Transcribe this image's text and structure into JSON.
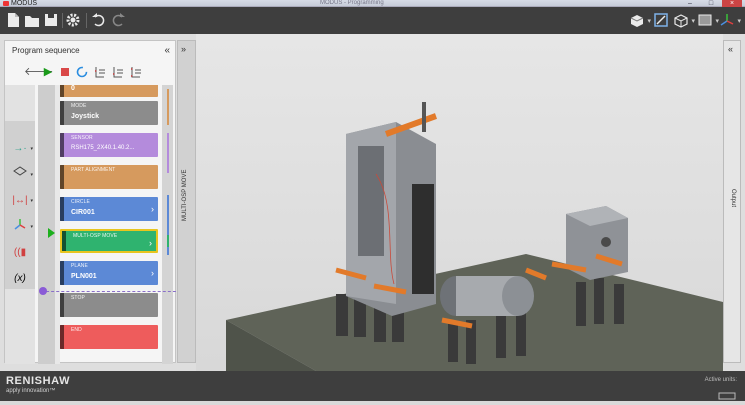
{
  "window": {
    "title": "MODUS",
    "center_text": "MODUS - Programming"
  },
  "toolbar": {
    "icons": [
      "new-file-icon",
      "open-folder-icon",
      "save-icon",
      "settings-icon",
      "undo-icon",
      "redo-icon"
    ],
    "right_icons": [
      "cube-icon",
      "zoom-fit-icon",
      "view-cube-icon",
      "display-mode-icon",
      "axes-icon"
    ]
  },
  "sequence": {
    "title": "Program sequence",
    "collapse": "«",
    "tools": [
      "back-icon",
      "play-icon",
      "stop-icon",
      "refresh-icon",
      "step-icon",
      "step-back-icon",
      "step-all-icon"
    ],
    "cards": [
      {
        "label": "",
        "value": "0",
        "color": "#d69a5e"
      },
      {
        "label": "MODE",
        "value": "Joystick",
        "color": "#8c8c8c"
      },
      {
        "label": "SENSOR",
        "value": "RSH175_2X40.1.40.2...",
        "color": "#b48bdc"
      },
      {
        "label": "PART ALIGNMENT",
        "value": "",
        "color": "#d69a5e"
      },
      {
        "label": "CIRCLE",
        "value": "CIR001",
        "color": "#5c89d6"
      },
      {
        "label": "MULTI-OSP MOVE",
        "value": "",
        "color": "#2fb36f"
      },
      {
        "label": "PLANE",
        "value": "PLN001",
        "color": "#5c89d6"
      },
      {
        "label": "STOP",
        "value": "",
        "color": "#8c8c8c"
      },
      {
        "label": "END",
        "value": "",
        "color": "#ee5c5c"
      }
    ]
  },
  "side_panel": {
    "title": "MULTI-OSP MOVE",
    "collapse": "»"
  },
  "output_panel": {
    "title": "Output",
    "collapse": "«"
  },
  "footer": {
    "brand": "RENISHAW",
    "tagline": "apply innovation™",
    "units": "Active units:"
  }
}
